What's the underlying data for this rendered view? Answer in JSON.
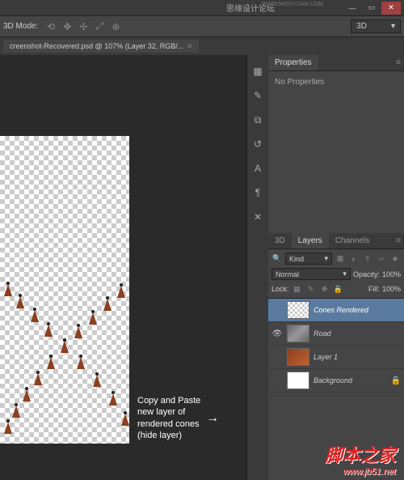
{
  "titlebar": {
    "title": ""
  },
  "watermarks": {
    "top_cn": "思缘设计论坛",
    "top_url": "WWW.MISSYUAN.COM",
    "bottom_cn": "脚本之家",
    "bottom_url": "www.jb51.net"
  },
  "toolbar": {
    "mode_label": "3D Mode:",
    "workspace": "3D"
  },
  "document": {
    "tab_title": "creenshot-Recovered.psd @ 107% (Layer 32, RGB/..."
  },
  "annotation": {
    "line1": "Copy and Paste",
    "line2": "new layer of",
    "line3": "rendered cones",
    "line4": "(hide layer)"
  },
  "properties_panel": {
    "tab": "Properties",
    "body": "No Properties"
  },
  "layers_panel": {
    "tabs": [
      "3D",
      "Layers",
      "Channels"
    ],
    "kind_label": "Kind",
    "blend_mode": "Normal",
    "opacity_label": "Opacity:",
    "opacity_value": "100%",
    "lock_label": "Lock:",
    "fill_label": "Fill:",
    "fill_value": "100%",
    "layers": [
      {
        "name": "Cones Rendered",
        "visible": false,
        "active": true,
        "thumb": "checker"
      },
      {
        "name": "Road",
        "visible": true,
        "active": false,
        "thumb": "road"
      },
      {
        "name": "Layer 1",
        "visible": false,
        "active": false,
        "thumb": "img"
      },
      {
        "name": "Background",
        "visible": false,
        "active": false,
        "thumb": "white"
      }
    ]
  }
}
